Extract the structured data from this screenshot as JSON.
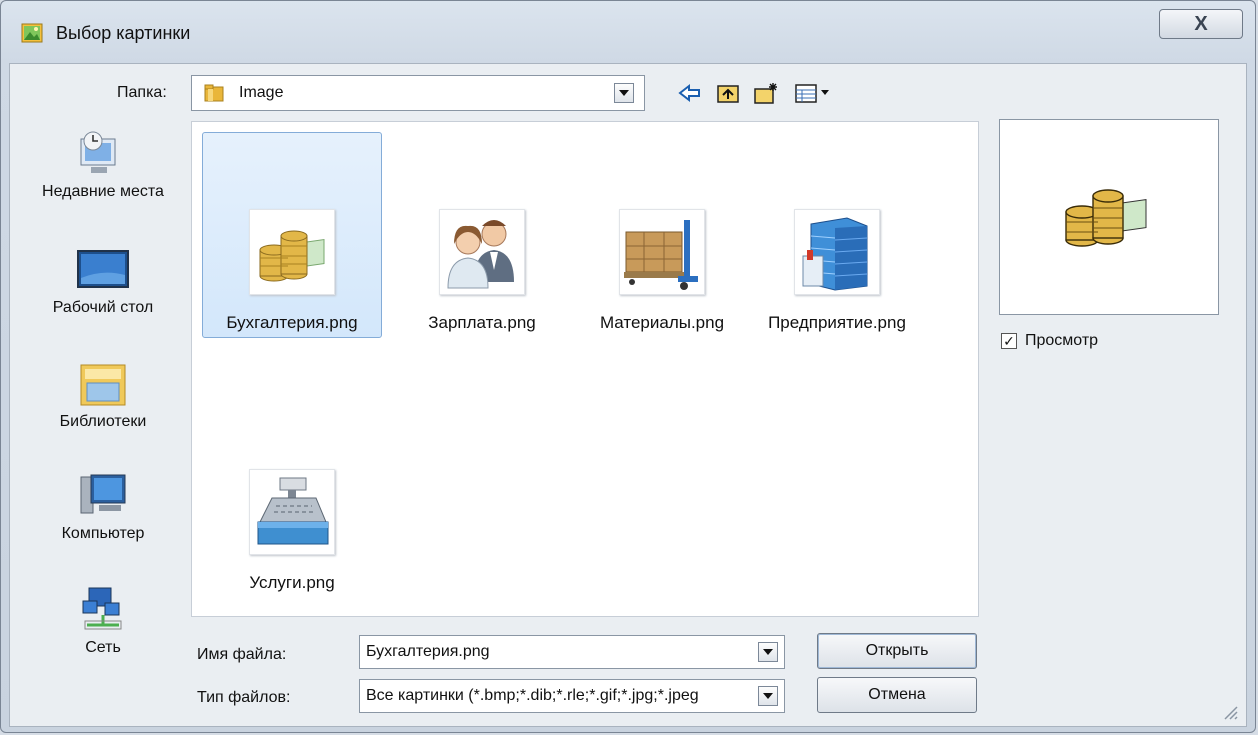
{
  "window": {
    "title": "Выбор картинки",
    "close_label": "X"
  },
  "toolbar": {
    "folder_label": "Папка:",
    "folder_name": "Image",
    "icons": [
      "back-arrow-icon",
      "up-folder-icon",
      "new-folder-icon",
      "view-menu-icon"
    ]
  },
  "places": [
    {
      "label": "Недавние места",
      "icon": "recent-places-icon"
    },
    {
      "label": "Рабочий стол",
      "icon": "desktop-icon"
    },
    {
      "label": "Библиотеки",
      "icon": "libraries-icon"
    },
    {
      "label": "Компьютер",
      "icon": "computer-icon"
    },
    {
      "label": "Сеть",
      "icon": "network-icon"
    }
  ],
  "files": [
    {
      "name": "Бухгалтерия.png",
      "icon": "coins-icon",
      "selected": true
    },
    {
      "name": "Зарплата.png",
      "icon": "people-icon",
      "selected": false
    },
    {
      "name": "Материалы.png",
      "icon": "pallet-boxes-icon",
      "selected": false
    },
    {
      "name": "Предприятие.png",
      "icon": "building-icon",
      "selected": false
    },
    {
      "name": "Услуги.png",
      "icon": "cash-register-icon",
      "selected": false
    }
  ],
  "preview": {
    "checkbox_label": "Просмотр",
    "checked": true
  },
  "form": {
    "filename_label": "Имя файла:",
    "filename_value": "Бухгалтерия.png",
    "filetype_label": "Тип файлов:",
    "filetype_value": "Все картинки (*.bmp;*.dib;*.rle;*.gif;*.jpg;*.jpeg",
    "open_label": "Открыть",
    "cancel_label": "Отмена"
  },
  "colors": {
    "selection_bg": "#d3e7fb",
    "selection_border": "#84acd8",
    "window_bg": "#cfd9e5"
  }
}
